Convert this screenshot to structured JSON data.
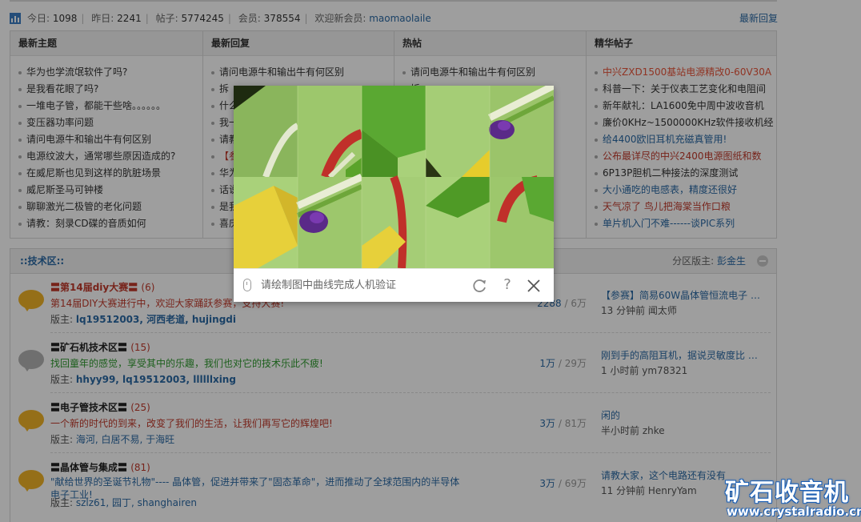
{
  "stats": {
    "today_label": "今日:",
    "today": "1098",
    "yesterday_label": "昨日:",
    "yesterday": "2241",
    "posts_label": "帖子:",
    "posts": "5774245",
    "members_label": "会员:",
    "members": "378554",
    "welcome_label": "欢迎新会员:",
    "new_member": "maomaolaile",
    "latest_replies_link": "最新回复"
  },
  "columns": [
    {
      "title": "最新主题",
      "items": [
        {
          "text": "华为也学流氓软件了吗?",
          "color": "#333333"
        },
        {
          "text": "是我看花眼了吗?",
          "color": "#333333"
        },
        {
          "text": "一堆电子管，都能干些啥。。。。。。",
          "color": "#333333"
        },
        {
          "text": "变压器功率问题",
          "color": "#333333"
        },
        {
          "text": "请问电源牛和输出牛有何区别",
          "color": "#333333"
        },
        {
          "text": "电源纹波大，通常哪些原因造成的?",
          "color": "#333333"
        },
        {
          "text": "在威尼斯也见到这样的肮脏场景",
          "color": "#333333"
        },
        {
          "text": "威尼斯圣马可钟楼",
          "color": "#333333"
        },
        {
          "text": "聊聊激光二极管的老化问题",
          "color": "#333333"
        },
        {
          "text": "请教：刻录CD碟的音质如何",
          "color": "#333333"
        }
      ]
    },
    {
      "title": "最新回复",
      "items": [
        {
          "text": "请问电源牛和输出牛有何区别",
          "color": "#333333"
        },
        {
          "text": "拆",
          "color": "#333333"
        },
        {
          "text": "什么",
          "color": "#333333"
        },
        {
          "text": "我一",
          "color": "#333333"
        },
        {
          "text": "请教",
          "color": "#333333"
        },
        {
          "text": "【参",
          "color": "#c0392b"
        },
        {
          "text": "华为",
          "color": "#333333"
        },
        {
          "text": "话说",
          "color": "#333333"
        },
        {
          "text": "是我",
          "color": "#333333"
        },
        {
          "text": "喜庆",
          "color": "#333333"
        }
      ]
    },
    {
      "title": "热帖",
      "items": [
        {
          "text": "请问电源牛和输出牛有何区别",
          "color": "#333333"
        },
        {
          "text": "拆",
          "color": "#333333"
        },
        {
          "text": "",
          "color": "#333333"
        },
        {
          "text": "",
          "color": "#333333"
        },
        {
          "text": "",
          "color": "#333333"
        },
        {
          "text": "",
          "color": "#333333"
        },
        {
          "text": "",
          "color": "#333333"
        },
        {
          "text": "",
          "color": "#333333"
        },
        {
          "text": "",
          "color": "#333333"
        },
        {
          "text": "",
          "color": "#333333"
        }
      ]
    },
    {
      "title": "精华帖子",
      "items": [
        {
          "text": "中兴ZXD1500基站电源精改0-60V30A",
          "color": "#e8553a"
        },
        {
          "text": "科普一下：关于仪表工艺变化和电阻间",
          "color": "#333333"
        },
        {
          "text": "新年献礼：LA1600免中周中波收音机",
          "color": "#333333"
        },
        {
          "text": "廉价0KHz~1500000KHz软件接收机经",
          "color": "#333333"
        },
        {
          "text": "给4400欧旧耳机充磁真管用!",
          "color": "#2b6aa5"
        },
        {
          "text": "公布最详尽的中兴2400电源图纸和数",
          "color": "#c0392b"
        },
        {
          "text": "6P13P胆机二种接法的深度测试",
          "color": "#333333"
        },
        {
          "text": "大小通吃的电感表，精度还很好",
          "color": "#2b6aa5"
        },
        {
          "text": "天气凉了 鸟儿把海棠当作口粮",
          "color": "#c0392b"
        },
        {
          "text": "单片机入门不难------谈PIC系列",
          "color": "#2b6aa5"
        }
      ]
    }
  ],
  "section": {
    "title": "::技术区::",
    "mod_label": "分区版主:",
    "mod_name": "彭金生"
  },
  "forums": [
    {
      "name": "〓第14届diy大赛〓",
      "count": "(6)",
      "name_color": "#c0392b",
      "desc": "第14届DIY大赛进行中，欢迎大家踊跃参赛，支持大赛!",
      "desc_color": "#c0392b",
      "mod_label": "版主:",
      "mods": "lq19512003, 河西老道, hujingdi",
      "threads": "2288",
      "posts": "6万",
      "last_title": "【参赛】简易60W晶体管恒流电子 …",
      "last_meta": "13 分钟前 闻太师",
      "icon_color": "#f0b428"
    },
    {
      "name": "〓矿石机技术区〓",
      "count": "(15)",
      "name_color": "#222222",
      "desc": "找回童年的感觉，享受其中的乐趣，我们也对它的技术乐此不疲!",
      "desc_color": "#2e9a2e",
      "mod_label": "版主:",
      "mods": "hhyy99, lq19512003, llllllxing",
      "threads": "1万",
      "posts": "29万",
      "last_title": "刚到手的高阻耳机，据说灵敏度比 …",
      "last_meta": "1 小时前 ym78321",
      "icon_color": "#b4b4b4"
    },
    {
      "name": "〓电子管技术区〓",
      "count": "(25)",
      "name_color": "#222222",
      "desc": "一个新的时代的到来，改变了我们的生活，让我们再写它的辉煌吧!",
      "desc_color": "#c0392b",
      "mod_label": "版主:",
      "mods": "海河, 白居不易, 于海旺",
      "threads": "3万",
      "posts": "81万",
      "last_title": "闲的",
      "last_meta": "半小时前 zhke",
      "icon_color": "#f0b428"
    },
    {
      "name": "〓晶体管与集成〓",
      "count": "(81)",
      "name_color": "#222222",
      "desc": "\"献给世界的圣诞节礼物\"---- 晶体管，促进并带来了\"固态革命\"，进而推动了全球范围内的半导体",
      "desc2": "电子工业!",
      "desc_color": "#2b6aa5",
      "mod_label": "版主:",
      "mods": "szlz61, 园丁, shanghairen",
      "threads": "3万",
      "posts": "69万",
      "last_title": "请教大家，这个电路还有没有",
      "last_meta": "11 分钟前 HenryYam",
      "icon_color": "#f0b428"
    }
  ],
  "captcha": {
    "instruction": "请绘制图中曲线完成人机验证",
    "help_glyph": "?"
  },
  "watermark": {
    "brand": "矿石收音机",
    "url": "www.crystalradio.cn"
  }
}
